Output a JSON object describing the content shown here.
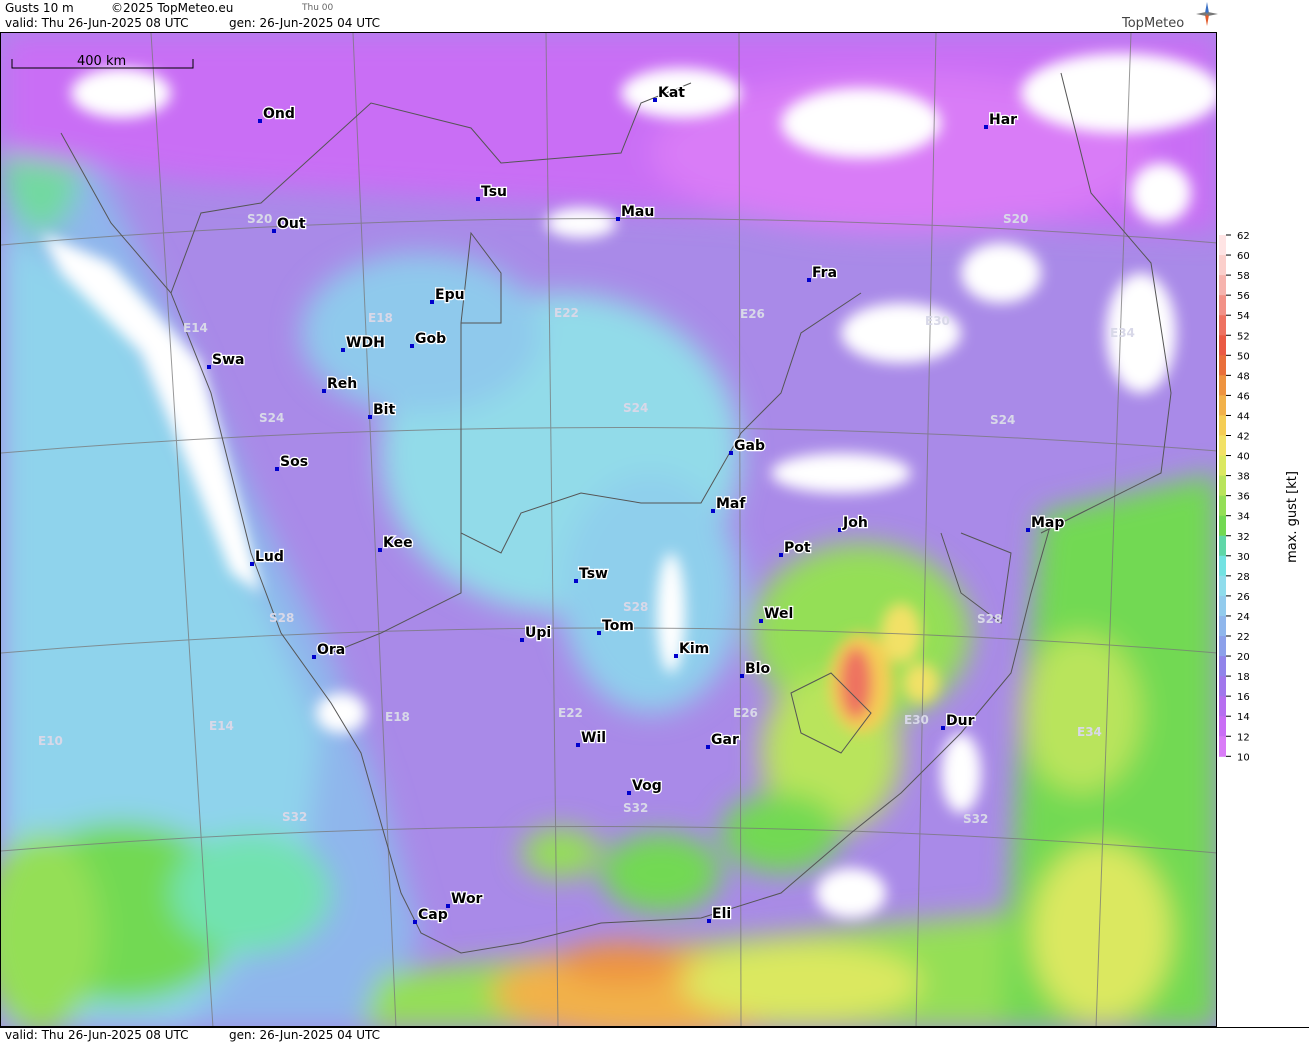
{
  "header": {
    "product": "Gusts 10 m",
    "copyright": "©2025 TopMeteo.eu",
    "valid": "valid:  Thu  26-Jun-2025  08 UTC",
    "generated": "gen:  26-Jun-2025 04 UTC",
    "run_tag": "Thu 00",
    "brand": "TopMeteo"
  },
  "footer": {
    "valid": "valid:  Thu  26-Jun-2025  08 UTC",
    "generated": "gen:  26-Jun-2025 04 UTC"
  },
  "scale_bar": {
    "label": "400 km"
  },
  "legend": {
    "unit_label": "max. gust  [kt]",
    "ticks": [
      62,
      60,
      58,
      56,
      54,
      52,
      50,
      48,
      46,
      44,
      42,
      40,
      38,
      36,
      34,
      32,
      30,
      28,
      26,
      24,
      22,
      20,
      18,
      16,
      14,
      12,
      10
    ],
    "colors": [
      "#ffe4e4",
      "#fbcfcb",
      "#f6b3ad",
      "#f29187",
      "#ee7261",
      "#ea5a44",
      "#e96f3b",
      "#ee9340",
      "#f2b14a",
      "#f5cd55",
      "#f2e166",
      "#dbe860",
      "#b9e45b",
      "#94df56",
      "#72d952",
      "#5fd7a8",
      "#72e2e2",
      "#8fdcec",
      "#92cbed",
      "#8fb6ec",
      "#8ca0ea",
      "#9184ea",
      "#a177ec",
      "#b66ff0",
      "#c96ef5",
      "#d97cf7"
    ]
  },
  "grid_labels": [
    "S20",
    "S20",
    "E14",
    "E18",
    "E22",
    "E26",
    "E30",
    "E34",
    "S24",
    "S24",
    "S24",
    "S28",
    "S28",
    "S28",
    "E18",
    "E22",
    "E26",
    "E30",
    "E14",
    "E10",
    "E34",
    "S32",
    "S32",
    "S32"
  ],
  "cities": [
    {
      "name": "Ond"
    },
    {
      "name": "Kat"
    },
    {
      "name": "Har"
    },
    {
      "name": "Tsu"
    },
    {
      "name": "Out"
    },
    {
      "name": "Mau"
    },
    {
      "name": "Fra"
    },
    {
      "name": "Epu"
    },
    {
      "name": "WDH"
    },
    {
      "name": "Gob"
    },
    {
      "name": "Swa"
    },
    {
      "name": "Reh"
    },
    {
      "name": "Bit"
    },
    {
      "name": "Gab"
    },
    {
      "name": "Sos"
    },
    {
      "name": "Maf"
    },
    {
      "name": "Joh"
    },
    {
      "name": "Map"
    },
    {
      "name": "Pot"
    },
    {
      "name": "Kee"
    },
    {
      "name": "Lud"
    },
    {
      "name": "Tsw"
    },
    {
      "name": "Wel"
    },
    {
      "name": "Upi"
    },
    {
      "name": "Tom"
    },
    {
      "name": "Kim"
    },
    {
      "name": "Ora"
    },
    {
      "name": "Blo"
    },
    {
      "name": "Dur"
    },
    {
      "name": "Wil"
    },
    {
      "name": "Gar"
    },
    {
      "name": "Vog"
    },
    {
      "name": "Wor"
    },
    {
      "name": "Cap"
    },
    {
      "name": "Eli"
    }
  ]
}
